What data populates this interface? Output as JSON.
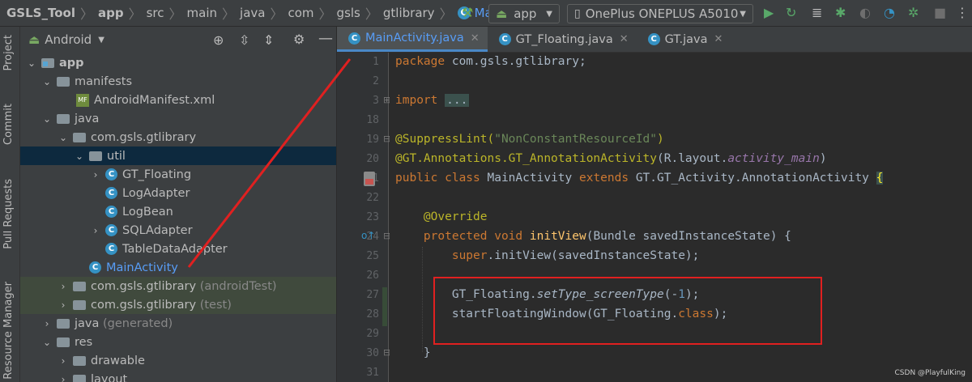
{
  "nav": {
    "breadcrumbs": [
      "GSLS_Tool",
      "app",
      "src",
      "main",
      "java",
      "com",
      "gsls",
      "gtlibrary",
      "MainActivity"
    ],
    "run_config": "app",
    "device": "OnePlus ONEPLUS A5010"
  },
  "sidebar_tabs": [
    "Project",
    "Commit",
    "Pull Requests",
    "Resource Manager"
  ],
  "project": {
    "view_mode": "Android",
    "tree": [
      {
        "label": "app",
        "extra": ""
      },
      {
        "label": "manifests",
        "extra": ""
      },
      {
        "label": "AndroidManifest.xml",
        "extra": ""
      },
      {
        "label": "java",
        "extra": ""
      },
      {
        "label": "com.gsls.gtlibrary",
        "extra": ""
      },
      {
        "label": "util",
        "extra": ""
      },
      {
        "label": "GT_Floating",
        "extra": ""
      },
      {
        "label": "LogAdapter",
        "extra": ""
      },
      {
        "label": "LogBean",
        "extra": ""
      },
      {
        "label": "SQLAdapter",
        "extra": ""
      },
      {
        "label": "TableDataAdapter",
        "extra": ""
      },
      {
        "label": "MainActivity",
        "extra": ""
      },
      {
        "label": "com.gsls.gtlibrary",
        "extra": "(androidTest)"
      },
      {
        "label": "com.gsls.gtlibrary",
        "extra": "(test)"
      },
      {
        "label": "java",
        "extra": "(generated)"
      },
      {
        "label": "res",
        "extra": ""
      },
      {
        "label": "drawable",
        "extra": ""
      },
      {
        "label": "layout",
        "extra": ""
      }
    ]
  },
  "tabs": [
    {
      "label": "MainActivity.java",
      "active": true
    },
    {
      "label": "GT_Floating.java",
      "active": false
    },
    {
      "label": "GT.java",
      "active": false
    }
  ],
  "code": {
    "line_numbers": [
      "1",
      "2",
      "3",
      "18",
      "19",
      "20",
      "21",
      "22",
      "23",
      "24",
      "25",
      "26",
      "27",
      "28",
      "29",
      "30",
      "31"
    ],
    "l1_kw": "package",
    "l1_rest": " com.gsls.gtlibrary;",
    "l3_kw": "import",
    "l3_fold": "...",
    "l19_ann": "@SuppressLint(",
    "l19_str": "\"NonConstantResourceId\"",
    "l19_close": ")",
    "l20_ann": "@GT.Annotations.GT_AnnotationActivity",
    "l20_a": "(R.layout.",
    "l20_it": "activity_main",
    "l20_b": ")",
    "l21_kw1": "public class",
    "l21_name": " MainActivity ",
    "l21_kw2": "extends",
    "l21_rest": " GT.GT_Activity.AnnotationActivity ",
    "l21_brace": "{",
    "l23_ann": "@Override",
    "l24_kw": "protected void",
    "l24_fn": "initView",
    "l24_rest": "(Bundle savedInstanceState) {",
    "l25_kw": "super",
    "l25_rest": ".initView(savedInstanceState);",
    "l27_a": "GT_Floating.",
    "l27_it": "setType_screenType",
    "l27_b": "(-",
    "l27_num": "1",
    "l27_c": ");",
    "l28_a": "startFloatingWindow(GT_Floating.",
    "l28_kw": "class",
    "l28_b": ");",
    "l30": "}"
  },
  "watermark": "CSDN @PlayfulKing",
  "colors": {
    "accent": "#589df6",
    "highlight_box": "#e02020",
    "arrow": "#e02020"
  }
}
